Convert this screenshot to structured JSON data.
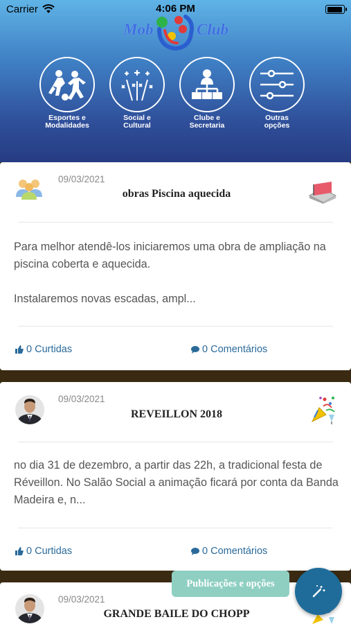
{
  "status_bar": {
    "carrier": "Carrier",
    "time": "4:06 PM"
  },
  "logo": {
    "left_text": "Mob",
    "right_text": "Club"
  },
  "menu": [
    {
      "label": "Esportes e\nModalidades",
      "icon": "sports-icon"
    },
    {
      "label": "Social e\nCultural",
      "icon": "fireworks-icon"
    },
    {
      "label": "Clube e\nSecretaria",
      "icon": "org-chart-icon"
    },
    {
      "label": "Outras\nopções",
      "icon": "sliders-icon"
    }
  ],
  "posts": [
    {
      "date": "09/03/2021",
      "title": "obras Piscina aquecida",
      "body": "Para melhor atendê-los iniciaremos uma obra de ampliação na piscina coberta e aquecida.\n\nInstalaremos novas escadas, ampl...",
      "likes": "0 Curtidas",
      "comments": "0 Comentários",
      "author_icon": "people-group-icon",
      "category_icon": "construction-icon"
    },
    {
      "date": "09/03/2021",
      "title": "REVEILLON 2018",
      "body": "no dia 31 de dezembro, a partir das 22h, a tradicional festa de Réveillon. No Salão Social a animação ficará por conta da Banda Madeira e, n...",
      "likes": "0 Curtidas",
      "comments": "0 Comentários",
      "author_icon": "avatar",
      "category_icon": "party-icon"
    },
    {
      "date": "09/03/2021",
      "title": "GRANDE BAILE DO CHOPP",
      "author_icon": "avatar",
      "category_icon": "party-icon"
    }
  ],
  "fab": {
    "label": "Publicações e opções",
    "icon": "magic-wand-icon"
  },
  "colors": {
    "header_top": "#5fb3e6",
    "header_bottom": "#263c82",
    "link": "#2a6a9a",
    "fab": "#1f6c9a",
    "fab_label": "#8ecfc2",
    "separator": "#3a2a12"
  }
}
